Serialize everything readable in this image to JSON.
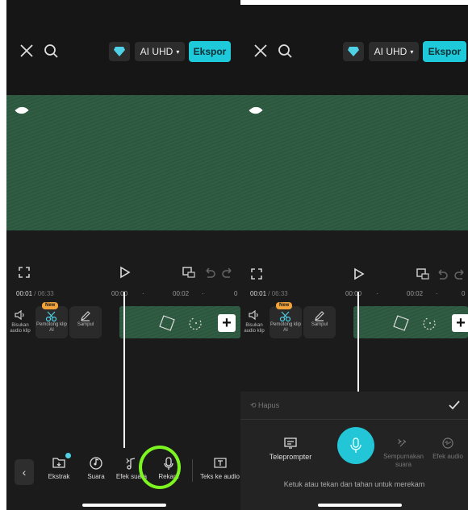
{
  "left": {
    "topbar": {
      "quality": "AI UHD",
      "export": "Ekspor"
    },
    "timeline": {
      "current": "00:01",
      "separator": " / ",
      "duration": "06:33",
      "tick1": "00:00",
      "tick2": "00:02",
      "tick3": "0"
    },
    "track": {
      "mute_label": "Bisukan audio klip",
      "new_badge": "New",
      "ai_cut_label": "Pemotong klip AI",
      "cover_label": "Sampul"
    },
    "toolbar": {
      "items": [
        "Ekstrak",
        "Suara",
        "Efek suara",
        "Rekam",
        "Teks ke audio"
      ]
    }
  },
  "right": {
    "topbar": {
      "quality": "AI UHD",
      "export": "Ekspor"
    },
    "timeline": {
      "current": "00:01",
      "separator": " / ",
      "duration": "06:33",
      "tick1": "00:00",
      "tick2": "00:02",
      "tick3": "0"
    },
    "track": {
      "mute_label": "Bisukan audio klip",
      "new_badge": "New",
      "ai_cut_label": "Pemotong klip AI",
      "cover_label": "Sampul"
    },
    "panel": {
      "delete": "Hapus",
      "teleprompter": "Teleprompter",
      "enhance": "Sempurnakan suara",
      "voice_effect": "Efek audio",
      "hint": "Ketuk atau tekan dan tahan untuk merekam"
    }
  },
  "colors": {
    "accent": "#1ec9d9",
    "highlight": "#7cf521",
    "clip_green": "#2f5c42",
    "badge": "#f2a23a"
  }
}
